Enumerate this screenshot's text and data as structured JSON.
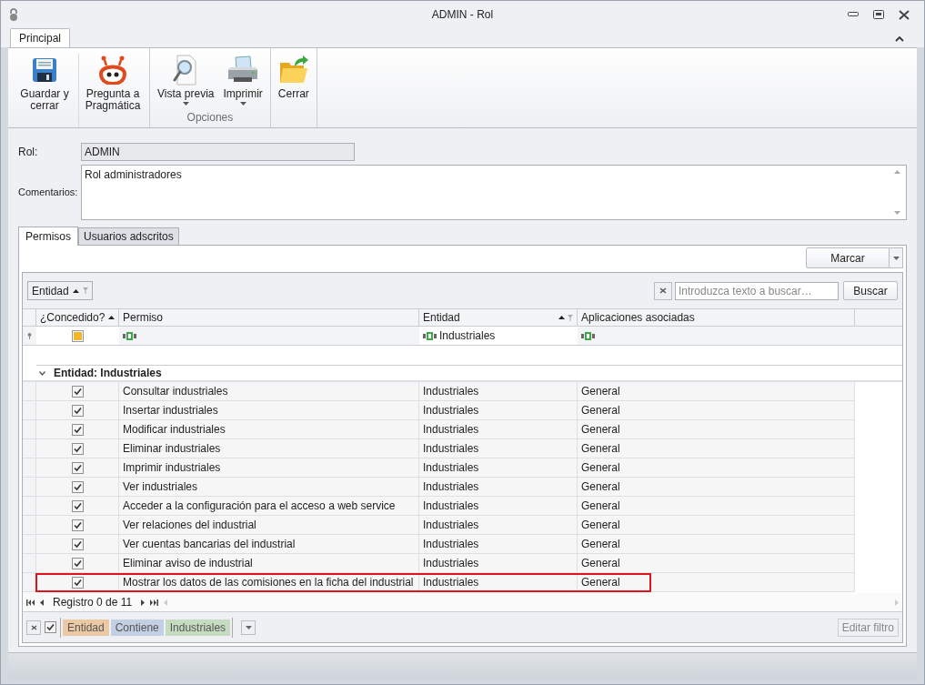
{
  "window": {
    "title": "ADMIN - Rol"
  },
  "ribbon": {
    "tabs": [
      {
        "label": "Principal",
        "selected": true
      }
    ],
    "groups": [
      {
        "buttons": [
          {
            "kind": "save",
            "label": "Guardar y cerrar",
            "dropdown": false
          },
          {
            "kind": "robot",
            "label": "Pregunta a Pragmática",
            "dropdown": false
          }
        ]
      },
      {
        "label": "Opciones",
        "buttons": [
          {
            "kind": "preview",
            "label": "Vista previa",
            "dropdown": true
          },
          {
            "kind": "print",
            "label": "Imprimir",
            "dropdown": true
          }
        ]
      },
      {
        "buttons": [
          {
            "kind": "close",
            "label": "Cerrar",
            "dropdown": false
          }
        ]
      }
    ]
  },
  "form": {
    "rol_label": "Rol:",
    "rol_value": "ADMIN",
    "comments_label": "Comentarios:",
    "comments_value": "Rol administradores"
  },
  "tabs": [
    {
      "label": "Permisos",
      "selected": true
    },
    {
      "label": "Usuarios adscritos",
      "selected": false
    }
  ],
  "mark_button": "Marcar",
  "group_panel": {
    "column": "Entidad"
  },
  "search": {
    "placeholder": "Introduzca texto a buscar…",
    "button": "Buscar"
  },
  "table": {
    "columns": [
      "¿Concedido?",
      "Permiso",
      "Entidad",
      "Aplicaciones  asociadas"
    ],
    "filter_row": {
      "indeterminate": true,
      "entidad": "Industriales"
    },
    "group": "Entidad: Industriales",
    "rows": [
      {
        "checked": true,
        "permiso": "Consultar industriales",
        "entidad": "Industriales",
        "aplicaciones": "General",
        "highlighted": false
      },
      {
        "checked": true,
        "permiso": "Insertar industriales",
        "entidad": "Industriales",
        "aplicaciones": "General",
        "highlighted": false
      },
      {
        "checked": true,
        "permiso": "Modificar industriales",
        "entidad": "Industriales",
        "aplicaciones": "General",
        "highlighted": false
      },
      {
        "checked": true,
        "permiso": "Eliminar industriales",
        "entidad": "Industriales",
        "aplicaciones": "General",
        "highlighted": false
      },
      {
        "checked": true,
        "permiso": "Imprimir industriales",
        "entidad": "Industriales",
        "aplicaciones": "General",
        "highlighted": false
      },
      {
        "checked": true,
        "permiso": "Ver industriales",
        "entidad": "Industriales",
        "aplicaciones": "General",
        "highlighted": false
      },
      {
        "checked": true,
        "permiso": "Acceder a la configuración para el acceso a web service",
        "entidad": "Industriales",
        "aplicaciones": "General",
        "highlighted": false
      },
      {
        "checked": true,
        "permiso": "Ver relaciones del industrial",
        "entidad": "Industriales",
        "aplicaciones": "General",
        "highlighted": false
      },
      {
        "checked": true,
        "permiso": "Ver cuentas bancarias del industrial",
        "entidad": "Industriales",
        "aplicaciones": "General",
        "highlighted": false
      },
      {
        "checked": true,
        "permiso": "Eliminar aviso de industrial",
        "entidad": "Industriales",
        "aplicaciones": "General",
        "highlighted": false
      },
      {
        "checked": true,
        "permiso": "Mostrar los datos de las comisiones en la ficha del industrial",
        "entidad": "Industriales",
        "aplicaciones": "General",
        "highlighted": true
      }
    ]
  },
  "navigator": {
    "text": "Registro 0 de 11"
  },
  "filter_bar": {
    "enabled": true,
    "tokens": [
      {
        "text": "Entidad",
        "color": "#ebc9a4"
      },
      {
        "text": "Contiene",
        "color": "#c3cfe2"
      },
      {
        "text": "Industriales",
        "color": "#c6dcc1"
      }
    ],
    "edit_button": "Editar filtro"
  }
}
